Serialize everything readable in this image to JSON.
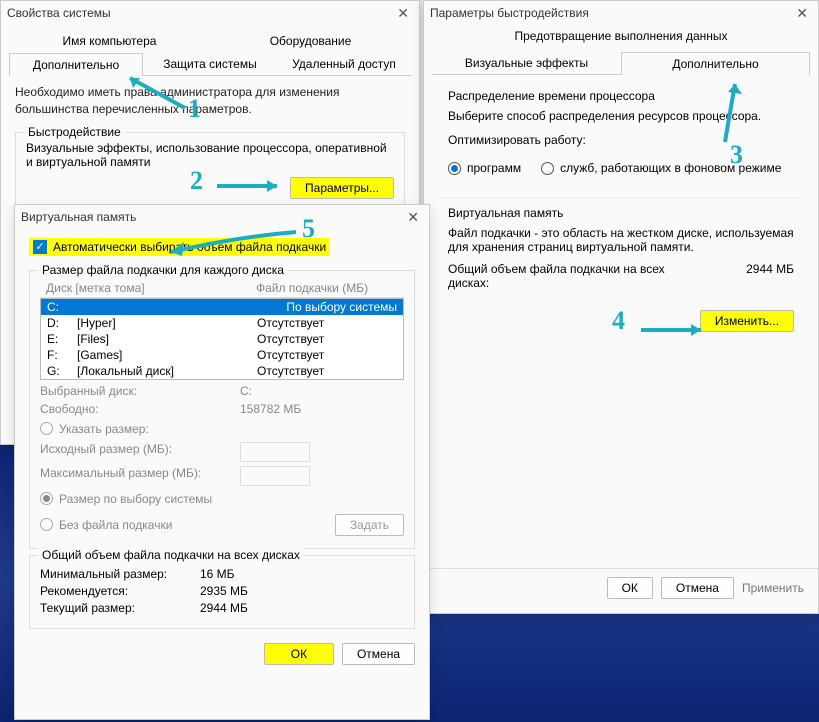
{
  "sysProps": {
    "title": "Свойства системы",
    "tabs": {
      "name": "Имя компьютера",
      "hardware": "Оборудование",
      "advanced": "Дополнительно",
      "protect": "Защита системы",
      "remote": "Удаленный доступ"
    },
    "adminText": "Необходимо иметь права администратора для изменения большинства перечисленных параметров.",
    "perf": {
      "title": "Быстродействие",
      "desc": "Визуальные эффекты, использование процессора, оперативной и виртуальной памяти",
      "btn": "Параметры..."
    }
  },
  "perfOpts": {
    "title": "Параметры быстродействия",
    "depTab": "Предотвращение выполнения данных",
    "tabs": {
      "visual": "Визуальные эффекты",
      "advanced": "Дополнительно"
    },
    "sched": {
      "title": "Распределение времени процессора",
      "desc": "Выберите способ распределения ресурсов процессора.",
      "optLabel": "Оптимизировать работу:",
      "programs": "программ",
      "services": "служб, работающих в фоновом режиме"
    },
    "vm": {
      "title": "Виртуальная память",
      "desc": "Файл подкачки - это область на жестком диске, используемая для хранения страниц виртуальной памяти.",
      "totalLabel": "Общий объем файла подкачки на всех дисках:",
      "totalVal": "2944 МБ",
      "changeBtn": "Изменить..."
    },
    "btns": {
      "ok": "ОК",
      "cancel": "Отмена",
      "apply": "Применить"
    }
  },
  "vmDialog": {
    "title": "Виртуальная память",
    "autoCheck": "Автоматически выбирать объем файла подкачки",
    "sizeTitle": "Размер файла подкачки для каждого диска",
    "listHeader": {
      "drive": "Диск [метка тома]",
      "pagefile": "Файл подкачки (МБ)"
    },
    "drives": [
      {
        "letter": "C:",
        "label": "",
        "status": "По выбору системы",
        "sel": true
      },
      {
        "letter": "D:",
        "label": "[Hyper]",
        "status": "Отсутствует"
      },
      {
        "letter": "E:",
        "label": "[Files]",
        "status": "Отсутствует"
      },
      {
        "letter": "F:",
        "label": "[Games]",
        "status": "Отсутствует"
      },
      {
        "letter": "G:",
        "label": "[Локальный диск]",
        "status": "Отсутствует"
      }
    ],
    "selDriveLabel": "Выбранный диск:",
    "selDriveVal": "C:",
    "freeLabel": "Свободно:",
    "freeVal": "158782 МБ",
    "customSize": "Указать размер:",
    "initSize": "Исходный размер (МБ):",
    "maxSize": "Максимальный размер (МБ):",
    "sysSize": "Размер по выбору системы",
    "noFile": "Без файла подкачки",
    "setBtn": "Задать",
    "totalTitle": "Общий объем файла подкачки на всех дисках",
    "minLabel": "Минимальный размер:",
    "minVal": "16 МБ",
    "recLabel": "Рекомендуется:",
    "recVal": "2935 МБ",
    "curLabel": "Текущий размер:",
    "curVal": "2944 МБ",
    "ok": "ОК",
    "cancel": "Отмена"
  },
  "annot": {
    "n1": "1",
    "n2": "2",
    "n3": "3",
    "n4": "4",
    "n5": "5"
  }
}
